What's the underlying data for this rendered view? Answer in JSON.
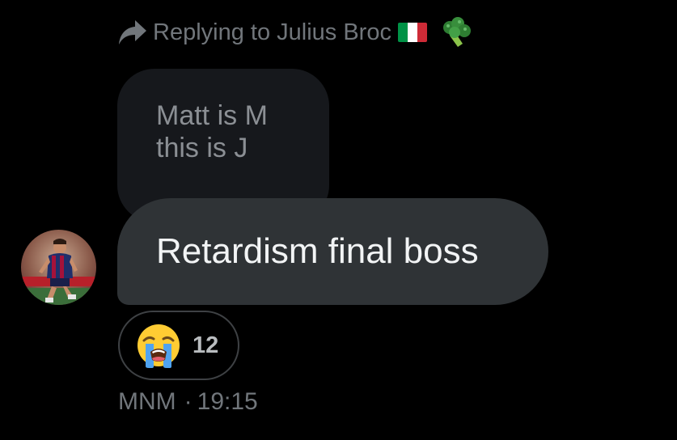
{
  "reply_header": {
    "prefix": "Replying to Julius Broc",
    "flag_icon": "italy-flag-icon",
    "flag_colors": [
      "#009246",
      "#ffffff",
      "#ce2b37"
    ],
    "emoji_icon": "broccoli-icon"
  },
  "quoted_message": {
    "line1": "Matt is M",
    "line2": "this is J"
  },
  "message": {
    "text": "Retardism final boss",
    "avatar_icon": "player-avatar"
  },
  "reaction": {
    "emoji_icon": "loudly-crying-face-icon",
    "count": "12"
  },
  "meta": {
    "sender": "MNM",
    "separator": "·",
    "time": "19:15"
  },
  "colors": {
    "background": "#000000",
    "bubble": "#2f3336",
    "quoted_bubble": "#16181c",
    "muted_text": "#71767b"
  }
}
